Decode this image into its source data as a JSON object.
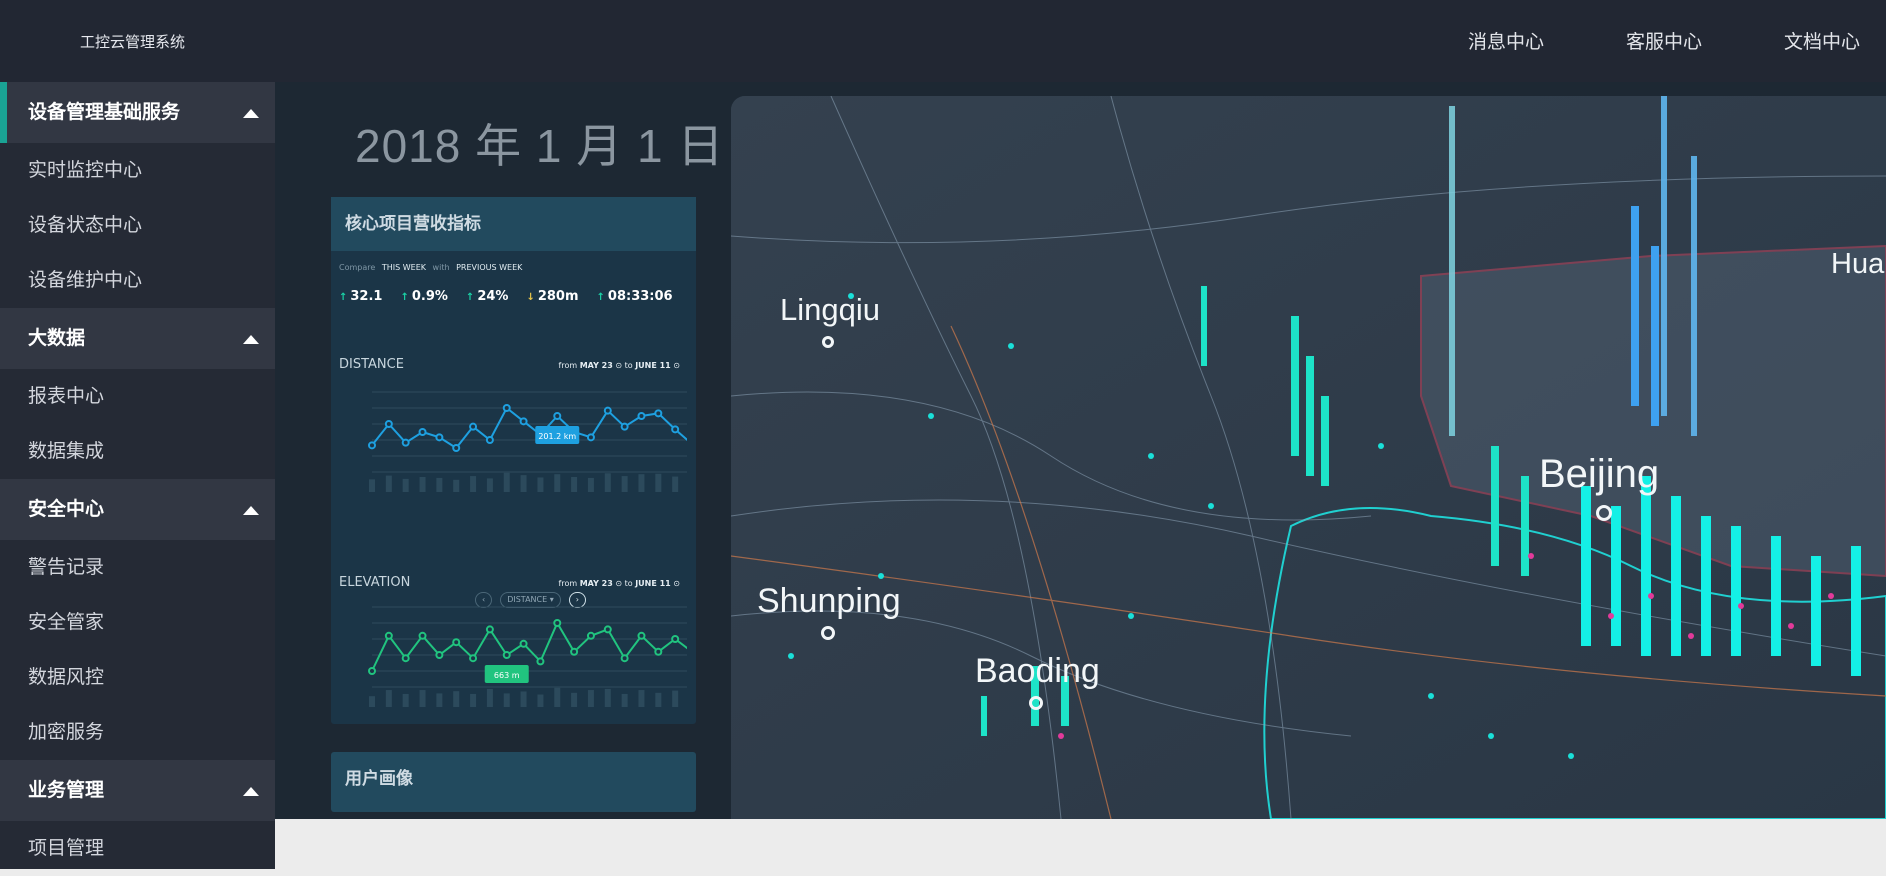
{
  "app": {
    "title": "工控云管理系统"
  },
  "topnav": [
    "消息中心",
    "客服中心",
    "文档中心"
  ],
  "sidebar": {
    "groups": [
      {
        "label": "设备管理基础服务",
        "items": [
          "实时监控中心",
          "设备状态中心",
          "设备维护中心"
        ]
      },
      {
        "label": "大数据",
        "items": [
          "报表中心",
          "数据集成"
        ]
      },
      {
        "label": "安全中心",
        "items": [
          "警告记录",
          "安全管家",
          "数据风控",
          "加密服务"
        ]
      },
      {
        "label": "业务管理",
        "items": [
          "项目管理"
        ]
      }
    ]
  },
  "dashboard": {
    "date": "2018 年 1 月 1 日",
    "panel_title": "核心项目营收指标",
    "compare": {
      "label": "Compare",
      "current": "THIS WEEK",
      "with": "with",
      "previous": "PREVIOUS WEEK"
    },
    "metrics": [
      {
        "value": "32.1",
        "trend": "up"
      },
      {
        "value": "0.9%",
        "trend": "up"
      },
      {
        "value": "24%",
        "trend": "up"
      },
      {
        "value": "280m",
        "trend": "down"
      },
      {
        "value": "08:33:06",
        "trend": "up"
      }
    ],
    "distance": {
      "title": "DISTANCE",
      "from_label": "from",
      "from": "MAY 23",
      "to": "JUNE 11",
      "tooltip": "201.2 km"
    },
    "elevation": {
      "title": "ELEVATION",
      "from_label": "from",
      "from": "MAY 23",
      "to": "JUNE 11",
      "tooltip": "663 m"
    },
    "pager": {
      "prev": "‹",
      "mode": "DISTANCE ▾",
      "next": "›"
    },
    "panel2_title": "用户画像"
  },
  "map": {
    "cities": [
      "Lingqiu",
      "Shunping",
      "Baoding",
      "Beijing",
      "Hua"
    ]
  },
  "chart_data": [
    {
      "type": "line",
      "title": "DISTANCE",
      "x": [
        1,
        2,
        3,
        4,
        5,
        6,
        7,
        8,
        9,
        10,
        11,
        12,
        13,
        14,
        15,
        16,
        17,
        18,
        19,
        20
      ],
      "values": [
        300,
        380,
        310,
        350,
        330,
        290,
        370,
        320,
        440,
        390,
        340,
        410,
        350,
        330,
        430,
        370,
        410,
        420,
        360,
        305
      ],
      "highlight_index": 11,
      "highlight_label": "201.2 km"
    },
    {
      "type": "line",
      "title": "ELEVATION",
      "x": [
        1,
        2,
        3,
        4,
        5,
        6,
        7,
        8,
        9,
        10,
        11,
        12,
        13,
        14,
        15,
        16,
        17,
        18,
        19,
        20
      ],
      "values": [
        300,
        520,
        380,
        520,
        400,
        480,
        380,
        560,
        400,
        470,
        360,
        600,
        420,
        520,
        560,
        380,
        520,
        420,
        500,
        420
      ],
      "highlight_index": 8,
      "highlight_label": "663 m"
    }
  ],
  "colors": {
    "accent": "#1aa394",
    "distance_line": "#1ea0e0",
    "elevation_line": "#21c47f"
  }
}
